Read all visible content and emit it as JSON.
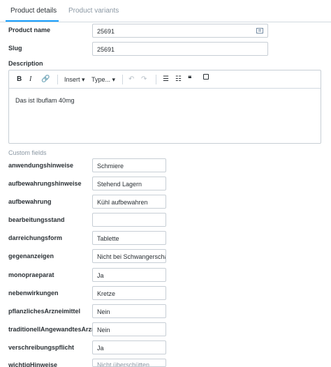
{
  "tabs": [
    {
      "label": "Product details"
    },
    {
      "label": "Product variants"
    }
  ],
  "product_name": {
    "label": "Product name",
    "value": "25691",
    "icon": "product-list-icon"
  },
  "slug": {
    "label": "Slug",
    "value": "25691"
  },
  "description": {
    "label": "Description",
    "toolbar": {
      "bold": "B",
      "italic": "I",
      "insert": "Insert ▾",
      "type": "Type... ▾",
      "quote": "❝"
    },
    "content": "Das ist Ibuflam 40mg"
  },
  "custom_fields": {
    "title": "Custom fields",
    "items": [
      {
        "label": "anwendungshinweise",
        "value": "Schmiere"
      },
      {
        "label": "aufbewahrungshinweise",
        "value": "Stehend Lagern"
      },
      {
        "label": "aufbewahrung",
        "value": "Kühl aufbewahren"
      },
      {
        "label": "bearbeitungsstand",
        "value": ""
      },
      {
        "label": "darreichungsform",
        "value": "Tablette"
      },
      {
        "label": "gegenanzeigen",
        "value": "Nicht bei Schwangerschaft"
      },
      {
        "label": "monopraeparat",
        "value": "Ja"
      },
      {
        "label": "nebenwirkungen",
        "value": "Kretze"
      },
      {
        "label": "pflanzlichesArzneimittel",
        "value": "Nein"
      },
      {
        "label": "traditionellAngewandtesArzneimittel",
        "value": "Nein"
      },
      {
        "label": "verschreibungspflicht",
        "value": "Ja"
      },
      {
        "label": "wichtigHinweise",
        "value": "Nicht überschütten"
      }
    ]
  }
}
